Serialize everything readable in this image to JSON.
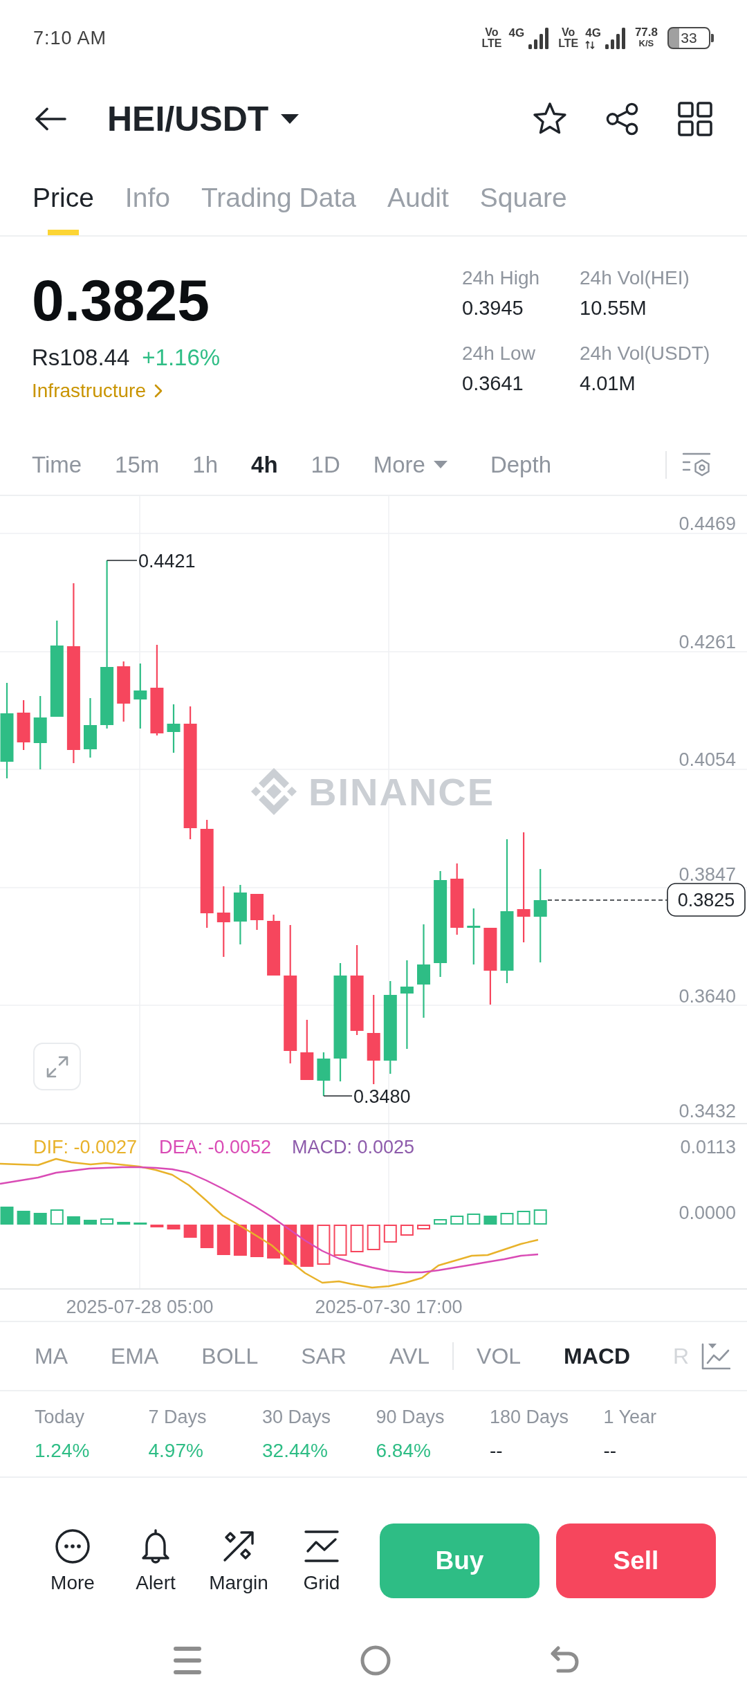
{
  "status_bar": {
    "time": "7:10 AM",
    "sims": [
      {
        "volte": "Vo LTE",
        "network": "4G",
        "data_active": false
      },
      {
        "volte": "Vo LTE",
        "network": "4G",
        "data_active": true
      }
    ],
    "speed": {
      "value": "77.8",
      "unit": "K/S"
    },
    "battery": "33"
  },
  "header": {
    "title": "HEI/USDT"
  },
  "tabs": [
    {
      "label": "Price",
      "selected": true
    },
    {
      "label": "Info",
      "selected": false
    },
    {
      "label": "Trading Data",
      "selected": false
    },
    {
      "label": "Audit",
      "selected": false
    },
    {
      "label": "Square",
      "selected": false
    }
  ],
  "ticker": {
    "last_price": "0.3825",
    "fiat_price": "Rs108.44",
    "change": "+1.16%",
    "change_positive": true,
    "category": "Infrastructure",
    "stats": [
      {
        "label": "24h High",
        "value": "0.3945"
      },
      {
        "label": "24h Vol(HEI)",
        "value": "10.55M"
      },
      {
        "label": "24h Low",
        "value": "0.3641"
      },
      {
        "label": "24h Vol(USDT)",
        "value": "4.01M"
      }
    ]
  },
  "intervals": [
    {
      "label": "Time",
      "selected": false,
      "kind": "option"
    },
    {
      "label": "15m",
      "selected": false,
      "kind": "option"
    },
    {
      "label": "1h",
      "selected": false,
      "kind": "option"
    },
    {
      "label": "4h",
      "selected": true,
      "kind": "option"
    },
    {
      "label": "1D",
      "selected": false,
      "kind": "option"
    },
    {
      "label": "More",
      "selected": false,
      "kind": "menu"
    },
    {
      "label": "Depth",
      "selected": false,
      "kind": "view"
    }
  ],
  "chart": {
    "watermark": "BINANCE",
    "price_ticks": [
      "0.4469",
      "0.4261",
      "0.4054",
      "0.3847",
      "0.3640",
      "0.3432"
    ],
    "high_marker": "0.4421",
    "low_marker": "0.3480",
    "last_price": "0.3825",
    "macd_legend": [
      {
        "text": "DIF: -0.0027",
        "color": "#e8b22a"
      },
      {
        "text": "DEA: -0.0052",
        "color": "#d94bb5"
      },
      {
        "text": "MACD: 0.0025",
        "color": "#8d5bab"
      }
    ],
    "macd_ticks": [
      "0.0113",
      "0.0000"
    ],
    "time_labels": [
      "2025-07-28 05:00",
      "2025-07-30 17:00"
    ]
  },
  "indicators": {
    "main": [
      {
        "label": "MA",
        "selected": false
      },
      {
        "label": "EMA",
        "selected": false
      },
      {
        "label": "BOLL",
        "selected": false
      },
      {
        "label": "SAR",
        "selected": false
      },
      {
        "label": "AVL",
        "selected": false
      }
    ],
    "sub": [
      {
        "label": "VOL",
        "selected": false
      },
      {
        "label": "MACD",
        "selected": true
      },
      {
        "label": "R",
        "selected": false
      }
    ]
  },
  "performance": [
    {
      "label": "Today",
      "value": "1.24%",
      "kind": "gain"
    },
    {
      "label": "7 Days",
      "value": "4.97%",
      "kind": "gain"
    },
    {
      "label": "30 Days",
      "value": "32.44%",
      "kind": "gain"
    },
    {
      "label": "90 Days",
      "value": "6.84%",
      "kind": "gain"
    },
    {
      "label": "180 Days",
      "value": "--",
      "kind": "empty"
    },
    {
      "label": "1 Year",
      "value": "--",
      "kind": "empty"
    }
  ],
  "actions": {
    "tools": [
      {
        "label": "More",
        "kind": "more"
      },
      {
        "label": "Alert",
        "kind": "alert"
      },
      {
        "label": "Margin",
        "kind": "margin"
      },
      {
        "label": "Grid",
        "kind": "grid"
      }
    ],
    "buttons": [
      {
        "label": "Buy",
        "kind": "buy"
      },
      {
        "label": "Sell",
        "kind": "sell"
      }
    ]
  }
}
